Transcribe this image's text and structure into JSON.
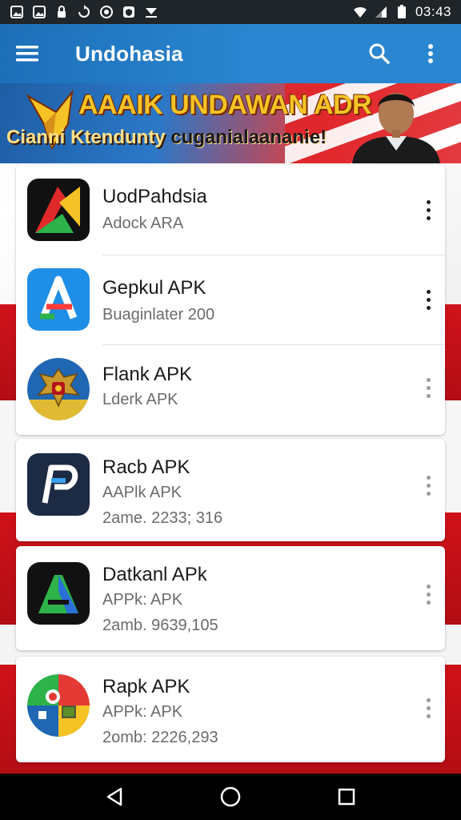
{
  "status_bar": {
    "time": "03:43",
    "left_icons": [
      "image-icon",
      "image-icon",
      "lock-icon",
      "sync-icon",
      "compass-icon",
      "shield-icon",
      "download-icon"
    ],
    "right_icons": [
      "wifi-icon",
      "signal-icon",
      "battery-icon"
    ]
  },
  "app_bar": {
    "title": "Undohasia",
    "menu_icon": "hamburger-menu-icon",
    "search_icon": "search-icon",
    "overflow_icon": "more-vert-icon",
    "color": "#2a86d1"
  },
  "banner": {
    "headline": "AAAIK UNDAWAN ADR",
    "subline_part1": "Cianni Ktendunty",
    "subline_part2": "cuganialaananie!"
  },
  "apps": [
    {
      "name": "UodPahdsia",
      "subtitle": "Adock ARA",
      "meta": "",
      "icon": "a-triangle-icon",
      "menu_style": "dark"
    },
    {
      "name": "Gepkul APK",
      "subtitle": "Buaginlater 200",
      "meta": "",
      "icon": "app-store-a-icon",
      "menu_style": "dark"
    },
    {
      "name": "Flank APK",
      "subtitle": "Lderk APK",
      "meta": "",
      "icon": "garuda-emblem-icon",
      "menu_style": "light"
    },
    {
      "name": "Racb APK",
      "subtitle": "AAPlk APK",
      "meta": "2ame. 2233; 316",
      "icon": "p-logo-icon",
      "menu_style": "light"
    },
    {
      "name": "Datkanl APk",
      "subtitle": "APPk: APK",
      "meta": "2amb. 9639,105",
      "icon": "a-green-icon",
      "menu_style": "light"
    },
    {
      "name": "Rapk APK",
      "subtitle": "APPk: APK",
      "meta": "2omb: 2226,293",
      "icon": "colorful-map-icon",
      "menu_style": "light"
    }
  ],
  "nav_bar": {
    "back_icon": "back-triangle-icon",
    "home_icon": "home-circle-icon",
    "recents_icon": "recents-square-icon"
  }
}
